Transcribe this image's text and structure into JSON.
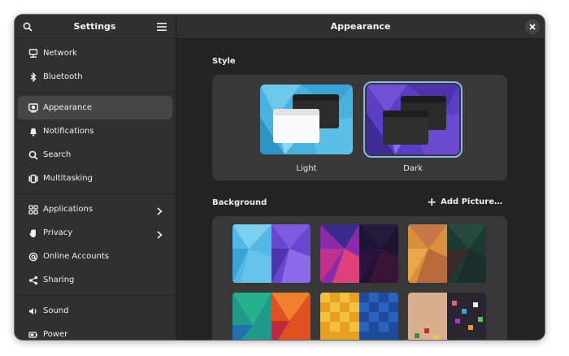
{
  "sidebar": {
    "title": "Settings",
    "search_icon": "search-icon",
    "menu_icon": "hamburger-menu-icon",
    "groups": [
      [
        {
          "label": "Network",
          "icon": "network-icon"
        },
        {
          "label": "Bluetooth",
          "icon": "bluetooth-icon"
        }
      ],
      [
        {
          "label": "Appearance",
          "icon": "appearance-icon",
          "active": true
        },
        {
          "label": "Notifications",
          "icon": "bell-icon"
        },
        {
          "label": "Search",
          "icon": "search-icon"
        },
        {
          "label": "Multitasking",
          "icon": "multitasking-icon"
        }
      ],
      [
        {
          "label": "Applications",
          "icon": "applications-icon",
          "chevron": true
        },
        {
          "label": "Privacy",
          "icon": "hand-icon",
          "chevron": true
        },
        {
          "label": "Online Accounts",
          "icon": "at-icon"
        },
        {
          "label": "Sharing",
          "icon": "share-icon"
        }
      ],
      [
        {
          "label": "Sound",
          "icon": "speaker-icon"
        },
        {
          "label": "Power",
          "icon": "power-icon"
        }
      ]
    ]
  },
  "main": {
    "title": "Appearance",
    "close_icon": "close-icon",
    "style": {
      "heading": "Style",
      "options": [
        {
          "label": "Light",
          "selected": false
        },
        {
          "label": "Dark",
          "selected": true
        }
      ]
    },
    "background": {
      "heading": "Background",
      "add_label": "Add Picture…"
    }
  },
  "colors": {
    "window_bg": "#242424",
    "sidebar_bg": "#303030",
    "card_bg": "#383838",
    "accent_outline": "#8fb3f0"
  }
}
